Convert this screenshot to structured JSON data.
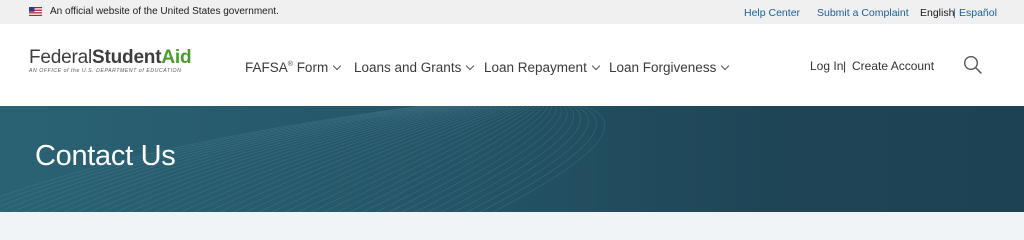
{
  "gov_banner": {
    "text": "An official website of the United States government.",
    "help_center": "Help Center",
    "submit_complaint": "Submit a Complaint",
    "lang_english": "English",
    "lang_separator": "|",
    "lang_espanol": "Español"
  },
  "header": {
    "logo": {
      "federal": "Federal",
      "student": "Student",
      "aid": "Aid",
      "tagline": "AN OFFICE of the U.S. DEPARTMENT of EDUCATION"
    },
    "nav": {
      "fafsa": "FAFSA",
      "fafsa_mark": "®",
      "fafsa_suffix": " Form",
      "loans_grants": "Loans and Grants",
      "loan_repayment": "Loan Repayment",
      "loan_forgiveness": "Loan Forgiveness"
    },
    "account": {
      "login": "Log In",
      "separator": "|",
      "create": "Create Account"
    }
  },
  "hero": {
    "title": "Contact Us"
  },
  "colors": {
    "brand_green": "#4b9b2e",
    "link_blue": "#1a5e9a",
    "hero_bg": "#1e4556"
  },
  "icons": {
    "flag": "us-flag-icon",
    "search": "search-icon",
    "chevron": "chevron-down-icon"
  }
}
